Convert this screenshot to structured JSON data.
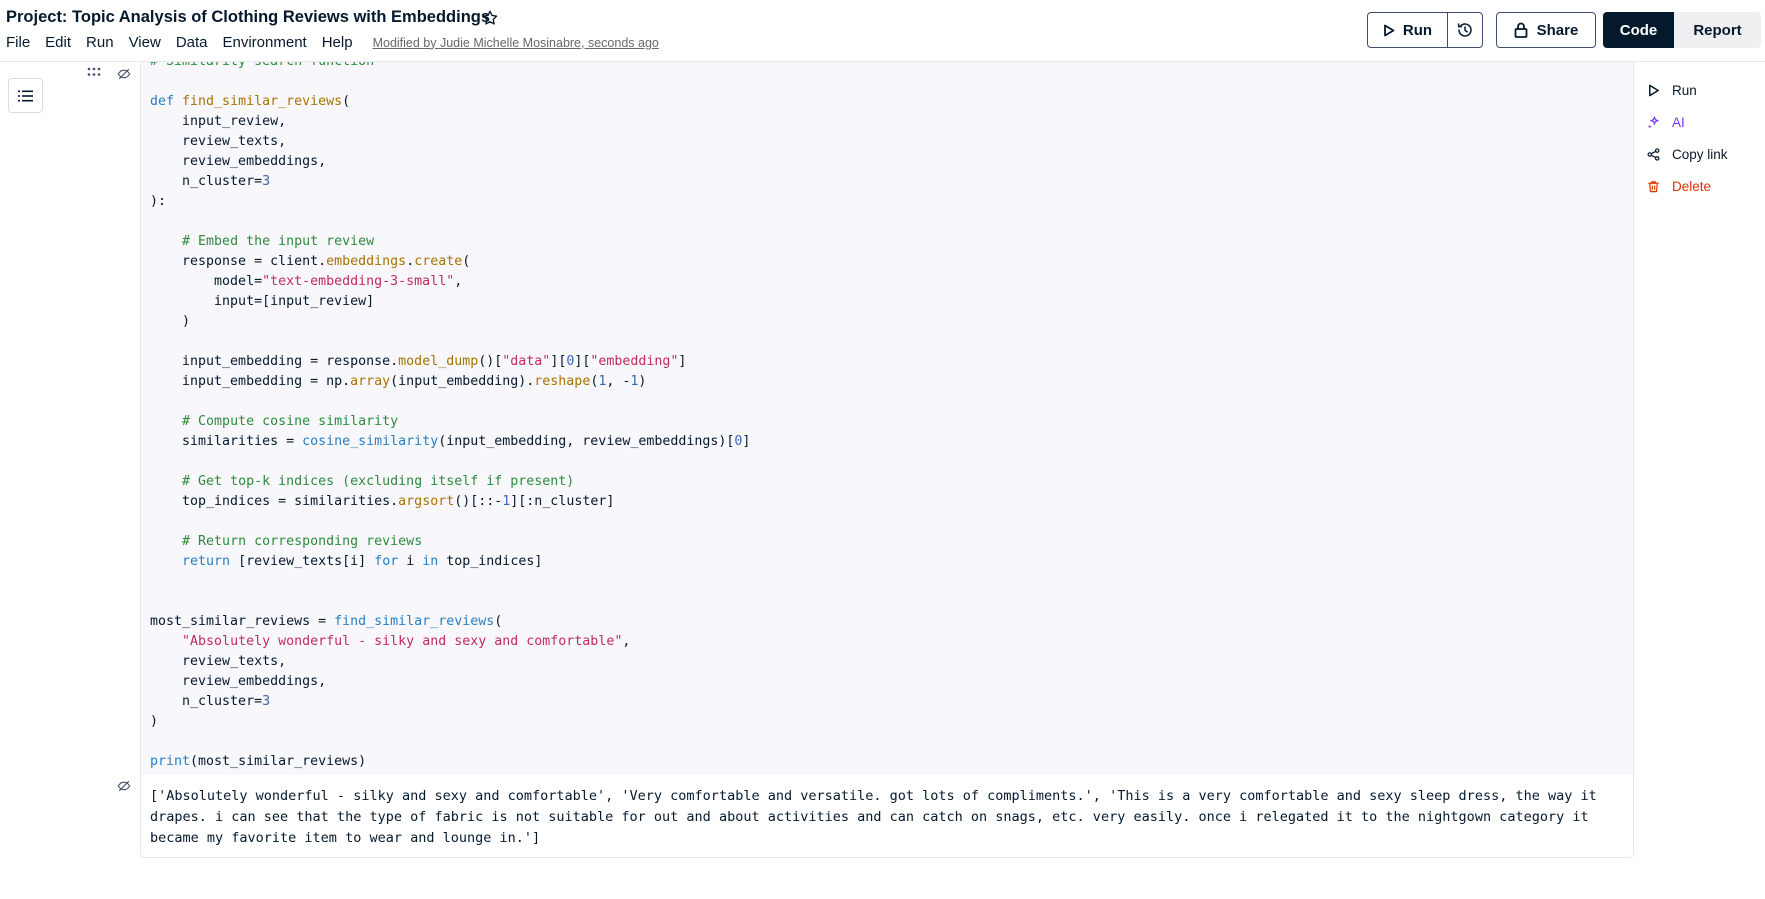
{
  "header": {
    "title": "Project: Topic Analysis of Clothing Reviews with Embeddings",
    "menu": [
      "File",
      "Edit",
      "Run",
      "View",
      "Data",
      "Environment",
      "Help"
    ],
    "modified_text": "Modified by Judie Michelle Mosinabre, seconds ago",
    "run_label": "Run",
    "share_label": "Share",
    "code_label": "Code",
    "report_label": "Report"
  },
  "cell_actions": [
    {
      "label": "Run",
      "icon": "play-icon",
      "color": "#05192d"
    },
    {
      "label": "AI",
      "icon": "sparkle-icon",
      "color": "#7933ff"
    },
    {
      "label": "Copy link",
      "icon": "share-node-icon",
      "color": "#05192d"
    },
    {
      "label": "Delete",
      "icon": "trash-icon",
      "color": "#dd3400"
    }
  ],
  "code_lines": [
    [
      {
        "t": "# Similarity search function",
        "c": "cm"
      }
    ],
    [],
    [
      {
        "t": "def ",
        "c": "kw"
      },
      {
        "t": "find_similar_reviews",
        "c": "fn"
      },
      {
        "t": "("
      }
    ],
    [
      {
        "t": "    input_review,"
      }
    ],
    [
      {
        "t": "    review_texts,"
      }
    ],
    [
      {
        "t": "    review_embeddings,"
      }
    ],
    [
      {
        "t": "    n_cluster="
      },
      {
        "t": "3",
        "c": "num"
      }
    ],
    [
      {
        "t": "):"
      }
    ],
    [],
    [
      {
        "t": "    "
      },
      {
        "t": "# Embed the input review",
        "c": "cm"
      }
    ],
    [
      {
        "t": "    response = client."
      },
      {
        "t": "embeddings",
        "c": "fn"
      },
      {
        "t": "."
      },
      {
        "t": "create",
        "c": "fn"
      },
      {
        "t": "("
      }
    ],
    [
      {
        "t": "        model="
      },
      {
        "t": "\"text-embedding-3-small\"",
        "c": "str"
      },
      {
        "t": ","
      }
    ],
    [
      {
        "t": "        input=[input_review]"
      }
    ],
    [
      {
        "t": "    )"
      }
    ],
    [],
    [
      {
        "t": "    input_embedding = response."
      },
      {
        "t": "model_dump",
        "c": "fn"
      },
      {
        "t": "()["
      },
      {
        "t": "\"data\"",
        "c": "str"
      },
      {
        "t": "]["
      },
      {
        "t": "0",
        "c": "num"
      },
      {
        "t": "]["
      },
      {
        "t": "\"embedding\"",
        "c": "str"
      },
      {
        "t": "]"
      }
    ],
    [
      {
        "t": "    input_embedding = np."
      },
      {
        "t": "array",
        "c": "fn"
      },
      {
        "t": "(input_embedding)."
      },
      {
        "t": "reshape",
        "c": "fn"
      },
      {
        "t": "("
      },
      {
        "t": "1",
        "c": "num"
      },
      {
        "t": ", -"
      },
      {
        "t": "1",
        "c": "num"
      },
      {
        "t": ")"
      }
    ],
    [],
    [
      {
        "t": "    "
      },
      {
        "t": "# Compute cosine similarity",
        "c": "cm"
      }
    ],
    [
      {
        "t": "    similarities = "
      },
      {
        "t": "cosine_similarity",
        "c": "call"
      },
      {
        "t": "(input_embedding, review_embeddings)["
      },
      {
        "t": "0",
        "c": "num"
      },
      {
        "t": "]"
      }
    ],
    [],
    [
      {
        "t": "    "
      },
      {
        "t": "# Get top-k indices (excluding itself if present)",
        "c": "cm"
      }
    ],
    [
      {
        "t": "    top_indices = similarities."
      },
      {
        "t": "argsort",
        "c": "fn"
      },
      {
        "t": "()[::-"
      },
      {
        "t": "1",
        "c": "num"
      },
      {
        "t": "][:n_cluster]"
      }
    ],
    [],
    [
      {
        "t": "    "
      },
      {
        "t": "# Return corresponding reviews",
        "c": "cm"
      }
    ],
    [
      {
        "t": "    "
      },
      {
        "t": "return",
        "c": "kw"
      },
      {
        "t": " [review_texts[i] "
      },
      {
        "t": "for",
        "c": "kw"
      },
      {
        "t": " i "
      },
      {
        "t": "in",
        "c": "kw"
      },
      {
        "t": " top_indices]"
      }
    ],
    [],
    [],
    [
      {
        "t": "most_similar_reviews = "
      },
      {
        "t": "find_similar_reviews",
        "c": "call"
      },
      {
        "t": "("
      }
    ],
    [
      {
        "t": "    "
      },
      {
        "t": "\"Absolutely wonderful - silky and sexy and comfortable\"",
        "c": "str"
      },
      {
        "t": ","
      }
    ],
    [
      {
        "t": "    review_texts,"
      }
    ],
    [
      {
        "t": "    review_embeddings,"
      }
    ],
    [
      {
        "t": "    n_cluster="
      },
      {
        "t": "3",
        "c": "num"
      }
    ],
    [
      {
        "t": ")"
      }
    ],
    [],
    [
      {
        "t": "print",
        "c": "call"
      },
      {
        "t": "(most_similar_reviews)"
      }
    ]
  ],
  "output_text": "['Absolutely wonderful - silky and sexy and comfortable', 'Very comfortable and versatile. got lots of compliments.', 'This is a very comfortable and sexy sleep dress, the way it drapes. i can see that the type of fabric is not suitable for out and about activities and can catch on snags, etc. very easily. once i relegated it to the nightgown category it became my favorite item to wear and lounge in.']"
}
